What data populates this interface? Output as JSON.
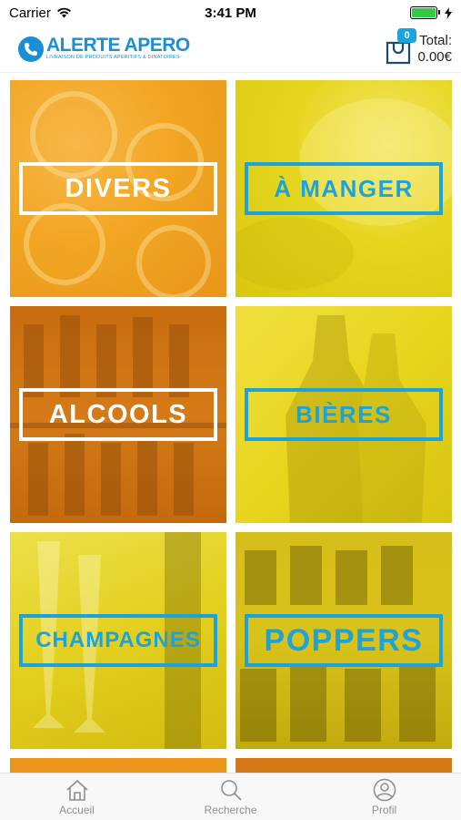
{
  "status_bar": {
    "carrier": "Carrier",
    "time": "3:41 PM"
  },
  "header": {
    "logo_title": "ALERTE APERO",
    "logo_subtitle": "LIVRAISON DE PRODUITS APERITIFS & DINATOIRES",
    "cart_count": "0",
    "total_label": "Total:",
    "total_value": "0.00€"
  },
  "categories": [
    {
      "label": "DIVERS",
      "color": "#f2a623"
    },
    {
      "label": "À MANGER",
      "color": "#e6d61f"
    },
    {
      "label": "ALCOOLS",
      "color": "#d57a17"
    },
    {
      "label": "BIÈRES",
      "color": "#e8d51e"
    },
    {
      "label": "CHAMPAGNES",
      "color": "#e3cf1d"
    },
    {
      "label": "POPPERS",
      "color": "#d9c21a"
    }
  ],
  "tabbar": {
    "home": "Accueil",
    "search": "Recherche",
    "profile": "Profil"
  },
  "colors": {
    "accent": "#1aa3dd",
    "brand": "#1a8fd6"
  }
}
